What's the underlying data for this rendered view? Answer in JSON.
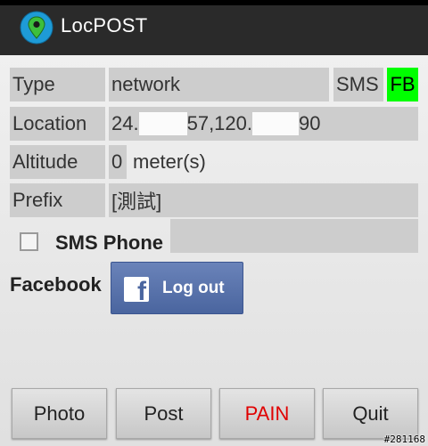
{
  "app": {
    "title": "LocPOST",
    "icon": "map-pin-icon",
    "accent": "#1e9bd7",
    "pin_color": "#3dbf3d"
  },
  "rows": {
    "type": {
      "label": "Type",
      "value": "network",
      "sms": "SMS",
      "fb": "FB",
      "fb_color": "#00ff00"
    },
    "location": {
      "label": "Location",
      "part1": "24.",
      "part2": "57,120.",
      "part3": "90"
    },
    "altitude": {
      "label": "Altitude",
      "value": "0",
      "unit": "meter(s)"
    },
    "prefix": {
      "label": "Prefix",
      "value": "[測試]"
    }
  },
  "sms_phone": {
    "label": "SMS Phone",
    "checked": false,
    "value": ""
  },
  "facebook": {
    "label": "Facebook",
    "button": "Log out",
    "icon": "facebook-icon",
    "brand": "#4a659f"
  },
  "buttons": {
    "photo": "Photo",
    "post": "Post",
    "pain": "PAIN",
    "quit": "Quit"
  },
  "watermark": "#281168"
}
